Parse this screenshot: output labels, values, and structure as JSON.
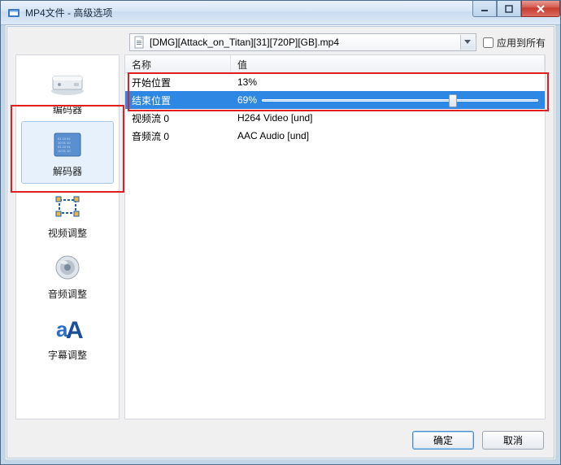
{
  "window": {
    "title": "MP4文件 - 高级选项"
  },
  "file": {
    "name": "[DMG][Attack_on_Titan][31][720P][GB].mp4",
    "apply_all_label": "应用到所有"
  },
  "sidebar": {
    "items": [
      {
        "label": "编码器",
        "icon": "encoder"
      },
      {
        "label": "解码器",
        "icon": "decoder"
      },
      {
        "label": "视频调整",
        "icon": "video-adjust"
      },
      {
        "label": "音频调整",
        "icon": "audio-adjust"
      },
      {
        "label": "字幕调整",
        "icon": "subtitle-adjust"
      }
    ],
    "selected_index": 1
  },
  "table": {
    "headers": {
      "name": "名称",
      "value": "值"
    },
    "rows": [
      {
        "name": "开始位置",
        "value": "13%",
        "slider": null
      },
      {
        "name": "结束位置",
        "value": "69%",
        "slider": 69,
        "selected": true
      },
      {
        "name": "视频流 0",
        "value": "H264 Video [und]"
      },
      {
        "name": "音频流 0",
        "value": "AAC Audio [und]"
      }
    ]
  },
  "buttons": {
    "ok": "确定",
    "cancel": "取消"
  }
}
